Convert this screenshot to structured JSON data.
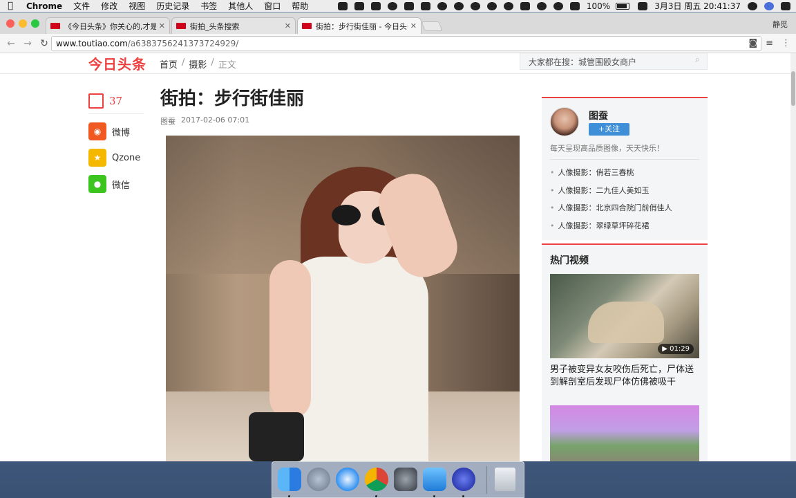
{
  "menubar": {
    "app": "Chrome",
    "items": [
      "文件",
      "修改",
      "视图",
      "历史记录",
      "书签",
      "其他人",
      "窗口",
      "帮助"
    ],
    "battery": "100%",
    "clock": "3月3日 周五  20:41:37"
  },
  "browser": {
    "tabs": [
      {
        "title": "《今日头条》你关心的,才是头条"
      },
      {
        "title": "街拍_头条搜索"
      },
      {
        "title": "街拍：步行街佳丽 - 今日头条(w"
      }
    ],
    "profile": "静觅",
    "url_domain": "www.toutiao.com",
    "url_path": "/a6383756241373724929/"
  },
  "site": {
    "logo": "今日头条",
    "breadcrumbs": [
      "首页",
      "摄影",
      "正文"
    ],
    "search_text": "大家都在搜：城管围殴女商户"
  },
  "share": {
    "comment_count": "37",
    "items": [
      {
        "label": "微博",
        "color": "#f05a22"
      },
      {
        "label": "Qzone",
        "color": "#f5b800"
      },
      {
        "label": "微信",
        "color": "#3cc51f"
      }
    ]
  },
  "article": {
    "title": "街拍：步行街佳丽",
    "author": "图蚕",
    "date": "2017-02-06 07:01"
  },
  "author_card": {
    "name": "图蚕",
    "follow": "+关注",
    "bio": "每天呈现高品质图像，天天快乐！",
    "related": [
      "人像摄影：俏若三春桃",
      "人像摄影：二九佳人美如玉",
      "人像摄影：北京四合院门前俏佳人",
      "人像摄影：翠绿草坪碎花裙"
    ]
  },
  "videos": {
    "heading": "热门视频",
    "first": {
      "duration": "01:29",
      "caption": "男子被变异女友咬伤后死亡，尸体送到解剖室后发现尸体仿佛被吸干"
    }
  },
  "colors": {
    "accent": "#ed4040",
    "follow": "#3e8fd8"
  }
}
